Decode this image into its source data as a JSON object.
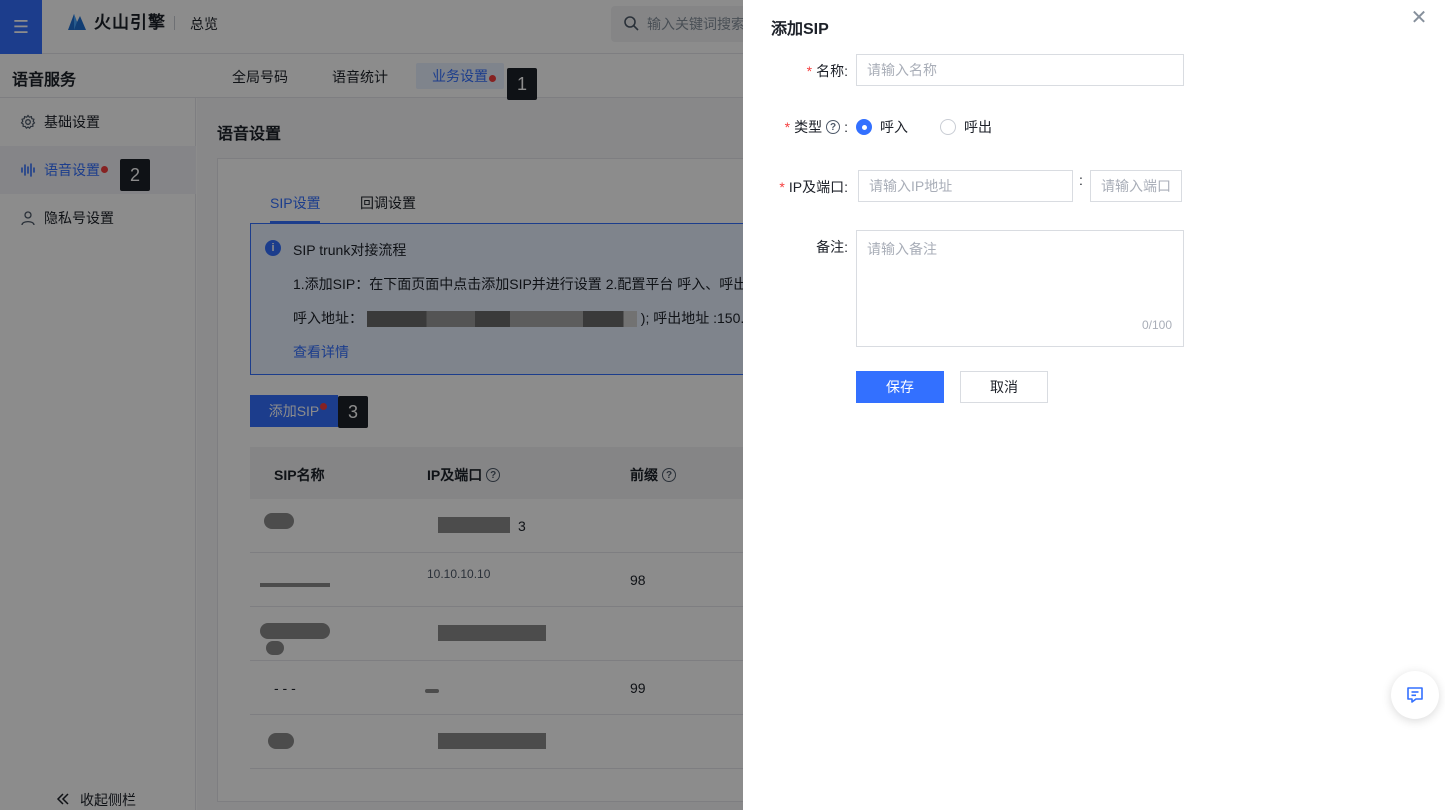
{
  "colors": {
    "brand": "#3370ff",
    "required": "#f53f3f",
    "badge_bg": "#1d2129",
    "overlay": "rgba(0,0,0,0.45)"
  },
  "topbar": {
    "menu_icon": "hamburger-icon",
    "logo_text": "火山引擎",
    "overview": "总览",
    "search_placeholder": "输入关键词搜索"
  },
  "subbar": {
    "service_title": "语音服务",
    "tabs": [
      {
        "label": "全局号码"
      },
      {
        "label": "语音统计"
      },
      {
        "label": "业务设置"
      }
    ]
  },
  "sidebar": {
    "items": [
      {
        "label": "基础设置",
        "icon": "gear-icon"
      },
      {
        "label": "语音设置",
        "icon": "waveform-icon"
      },
      {
        "label": "隐私号设置",
        "icon": "user-icon"
      }
    ],
    "collapse_label": "收起侧栏"
  },
  "main": {
    "title": "语音设置",
    "inner_tabs": [
      {
        "label": "SIP设置"
      },
      {
        "label": "回调设置"
      }
    ],
    "info": {
      "title": "SIP trunk对接流程",
      "step_line": "1.添加SIP：在下面页面中点击添加SIP并进行设置  2.配置平台 呼入、呼出",
      "addr_prefix": "呼入地址：",
      "addr_suffix": "); 呼出地址 :150.",
      "link": "查看详情"
    },
    "add_sip_label": "添加SIP",
    "table": {
      "columns": [
        "SIP名称",
        "IP及端口",
        "前缀"
      ],
      "rows": [
        {
          "ip": "3",
          "prefix": ""
        },
        {
          "ip": "10.10.10.10",
          "prefix": "98"
        },
        {
          "ip": "",
          "prefix": ""
        },
        {
          "name": "- - -",
          "ip": "",
          "prefix": "99"
        },
        {
          "ip": "",
          "prefix": ""
        }
      ]
    }
  },
  "badges": [
    "1",
    "2",
    "3"
  ],
  "drawer": {
    "title": "添加SIP",
    "close_icon": "close-icon",
    "form": {
      "name": {
        "label": "名称:",
        "placeholder": "请输入名称",
        "value": ""
      },
      "type": {
        "label": "类型",
        "help_icon": "question-circle-icon",
        "colon": ":",
        "options": [
          "呼入",
          "呼出"
        ],
        "selected": "呼入"
      },
      "ip_port": {
        "label": "IP及端口:",
        "ip_placeholder": "请输入IP地址",
        "separator": ":",
        "port_placeholder": "请输入端口"
      },
      "remark": {
        "label": "备注:",
        "placeholder": "请输入备注",
        "counter": "0/100"
      }
    },
    "buttons": {
      "save": "保存",
      "cancel": "取消"
    },
    "float_icon": "chat-icon"
  }
}
